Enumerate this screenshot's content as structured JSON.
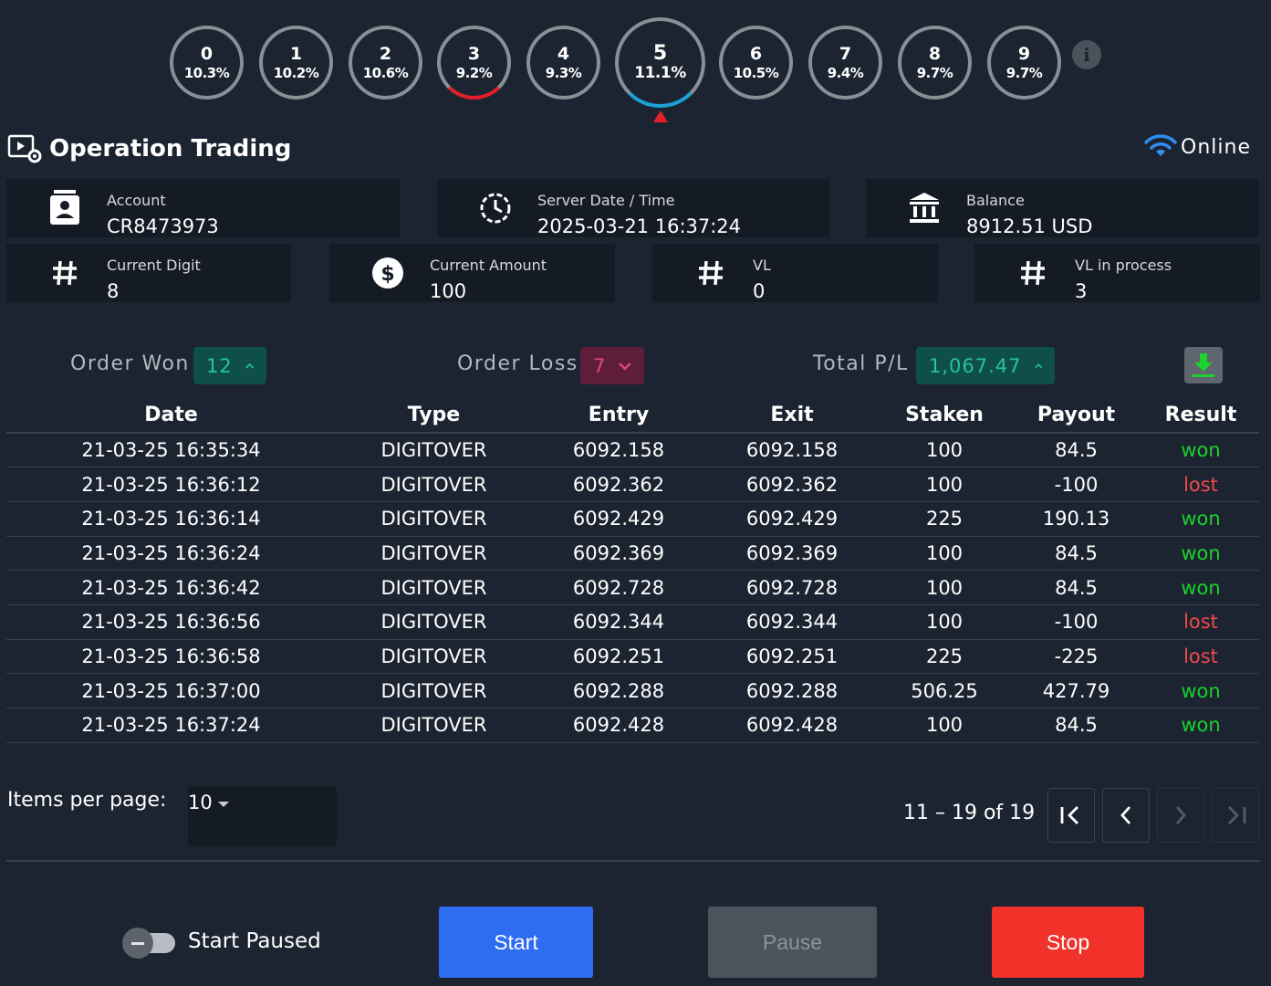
{
  "digits": [
    {
      "digit": "0",
      "percent": "10.3%"
    },
    {
      "digit": "1",
      "percent": "10.2%"
    },
    {
      "digit": "2",
      "percent": "10.6%"
    },
    {
      "digit": "3",
      "percent": "9.2%"
    },
    {
      "digit": "4",
      "percent": "9.3%"
    },
    {
      "digit": "5",
      "percent": "11.1%"
    },
    {
      "digit": "6",
      "percent": "10.5%"
    },
    {
      "digit": "7",
      "percent": "9.4%"
    },
    {
      "digit": "8",
      "percent": "9.7%"
    },
    {
      "digit": "9",
      "percent": "9.7%"
    }
  ],
  "header": {
    "title": "Operation Trading",
    "status": "Online"
  },
  "cards": {
    "account": {
      "label": "Account",
      "value": "CR8473973"
    },
    "server_time": {
      "label": "Server Date / Time",
      "value": "2025-03-21 16:37:24"
    },
    "balance": {
      "label": "Balance",
      "value": "8912.51 USD"
    },
    "current_digit": {
      "label": "Current Digit",
      "value": "8"
    },
    "current_amount": {
      "label": "Current Amount",
      "value": "100"
    },
    "vl": {
      "label": "VL",
      "value": "0"
    },
    "vl_in_process": {
      "label": "VL in process",
      "value": "3"
    }
  },
  "summary": {
    "won_label": "Order Won",
    "won_value": "12",
    "loss_label": "Order Loss",
    "loss_value": "7",
    "total_label": "Total P/L",
    "total_value": "1,067.47"
  },
  "table": {
    "headers": [
      "Date",
      "Type",
      "Entry",
      "Exit",
      "Staken",
      "Payout",
      "Result"
    ],
    "rows": [
      [
        "21-03-25 16:35:34",
        "DIGITOVER",
        "6092.158",
        "6092.158",
        "100",
        "84.5",
        "won"
      ],
      [
        "21-03-25 16:36:12",
        "DIGITOVER",
        "6092.362",
        "6092.362",
        "100",
        "-100",
        "lost"
      ],
      [
        "21-03-25 16:36:14",
        "DIGITOVER",
        "6092.429",
        "6092.429",
        "225",
        "190.13",
        "won"
      ],
      [
        "21-03-25 16:36:24",
        "DIGITOVER",
        "6092.369",
        "6092.369",
        "100",
        "84.5",
        "won"
      ],
      [
        "21-03-25 16:36:42",
        "DIGITOVER",
        "6092.728",
        "6092.728",
        "100",
        "84.5",
        "won"
      ],
      [
        "21-03-25 16:36:56",
        "DIGITOVER",
        "6092.344",
        "6092.344",
        "100",
        "-100",
        "lost"
      ],
      [
        "21-03-25 16:36:58",
        "DIGITOVER",
        "6092.251",
        "6092.251",
        "225",
        "-225",
        "lost"
      ],
      [
        "21-03-25 16:37:00",
        "DIGITOVER",
        "6092.288",
        "6092.288",
        "506.25",
        "427.79",
        "won"
      ],
      [
        "21-03-25 16:37:24",
        "DIGITOVER",
        "6092.428",
        "6092.428",
        "100",
        "84.5",
        "won"
      ]
    ]
  },
  "pagination": {
    "items_label": "Items per page:",
    "items_value": "10",
    "range": "11 – 19 of 19"
  },
  "controls": {
    "toggle_label": "Start Paused",
    "start": "Start",
    "pause": "Pause",
    "stop": "Stop"
  },
  "colors": {
    "background": "#1c2431",
    "card": "#151b25",
    "won": "#1bd12b",
    "lost": "#ef4a4a",
    "start": "#2e6cf2",
    "stop": "#f1322b"
  }
}
